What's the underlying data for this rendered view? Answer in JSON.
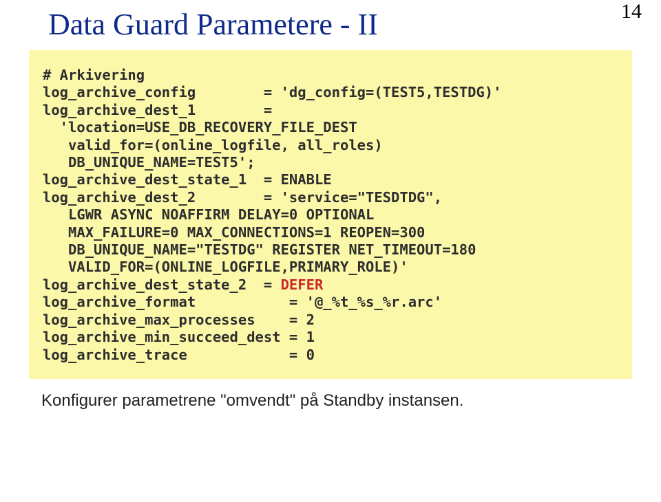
{
  "page_number": "14",
  "title": "Data Guard Parametere - II",
  "code": {
    "c01": "# Arkivering",
    "c02": "log_archive_config        = 'dg_config=(TEST5,TESTDG)'",
    "c03": "",
    "c04": "log_archive_dest_1        =",
    "c05": "  'location=USE_DB_RECOVERY_FILE_DEST",
    "c06": "   valid_for=(online_logfile, all_roles)",
    "c07": "   DB_UNIQUE_NAME=TEST5';",
    "c08": "log_archive_dest_state_1  = ENABLE",
    "c09": "",
    "c10": "log_archive_dest_2        = 'service=\"TESDTDG\",",
    "c11": "   LGWR ASYNC NOAFFIRM DELAY=0 OPTIONAL",
    "c12": "   MAX_FAILURE=0 MAX_CONNECTIONS=1 REOPEN=300",
    "c13": "   DB_UNIQUE_NAME=\"TESTDG\" REGISTER NET_TIMEOUT=180",
    "c14": "   VALID_FOR=(ONLINE_LOGFILE,PRIMARY_ROLE)'",
    "c15a": "log_archive_dest_state_2  = ",
    "c15b": "DEFER",
    "c16": "",
    "c17": "log_archive_format           = '@_%t_%s_%r.arc'",
    "c18": "log_archive_max_processes    = 2",
    "c19": "log_archive_min_succeed_dest = 1",
    "c20": "log_archive_trace            = 0"
  },
  "caption": "Konfigurer parametrene \"omvendt\" på Standby instansen."
}
